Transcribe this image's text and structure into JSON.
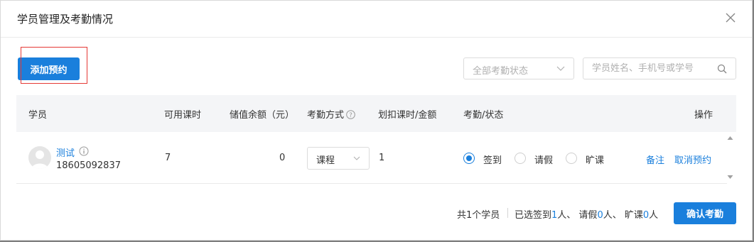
{
  "dialog": {
    "title": "学员管理及考勤情况",
    "close_icon": "close-icon"
  },
  "toolbar": {
    "add_label": "添加预约",
    "status_select_placeholder": "全部考勤状态",
    "search_placeholder": "学员姓名、手机号或学号",
    "search_icon": "search-icon"
  },
  "table": {
    "headers": {
      "student": "学员",
      "available_hours": "可用课时",
      "balance": "储值余额（元）",
      "attendance_mode": "考勤方式",
      "deduct": "划扣课时/金额",
      "attendance_status": "考勤/状态",
      "actions": "操作"
    },
    "rows": [
      {
        "name": "测试",
        "phone": "18605092837",
        "available_hours": "7",
        "balance": "0",
        "mode": "课程",
        "deduct": "1",
        "status_options": [
          "签到",
          "请假",
          "旷课"
        ],
        "selected_status": "签到",
        "actions": [
          "备注",
          "取消预约"
        ]
      }
    ]
  },
  "footer": {
    "total": "共1个学员",
    "summary_prefix": "已选签到",
    "checkin_count": "1",
    "unit_sep_1": "人、 请假",
    "leave_count": "0",
    "unit_sep_2": "人、 旷课",
    "absent_count": "0",
    "unit_suffix": "人",
    "confirm_label": "确认考勤"
  },
  "colors": {
    "primary": "#1a7fdc",
    "highlight": "#e53935"
  }
}
